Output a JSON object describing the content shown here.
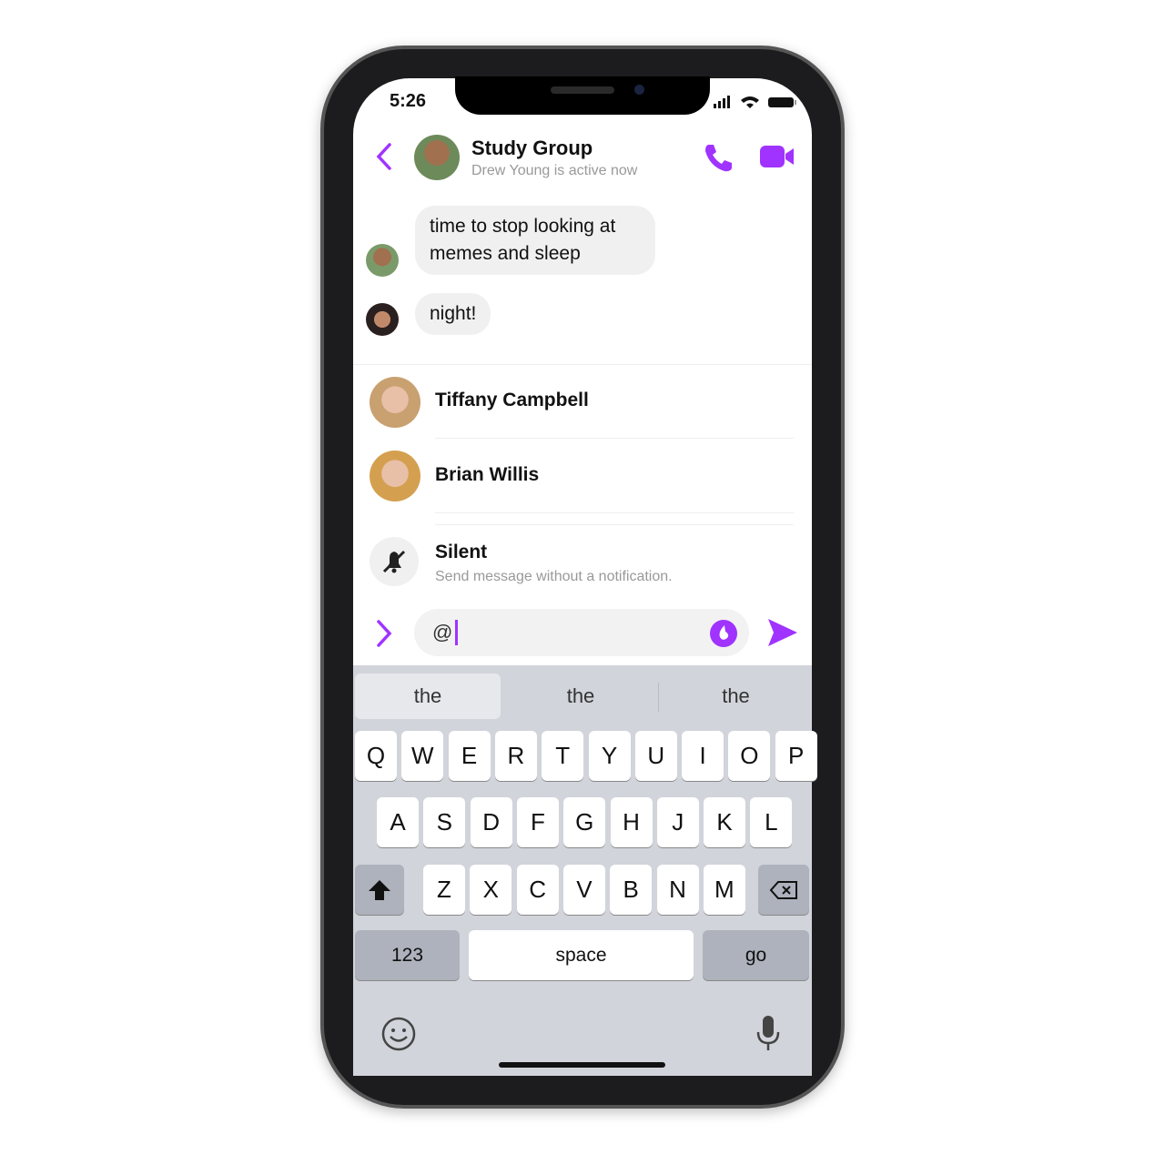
{
  "status": {
    "time": "5:26"
  },
  "header": {
    "title": "Study Group",
    "subtitle": "Drew Young is active now",
    "accent": "#a033ff"
  },
  "messages": [
    {
      "text": "time to stop looking at memes and sleep"
    },
    {
      "text": "night!"
    }
  ],
  "mentions": [
    {
      "name": "Tiffany Campbell"
    },
    {
      "name": "Brian Willis"
    }
  ],
  "silent": {
    "title": "Silent",
    "description": "Send message without a notification."
  },
  "composer": {
    "value": "@"
  },
  "keyboard": {
    "suggestions": [
      "the",
      "the",
      "the"
    ],
    "row1": [
      "Q",
      "W",
      "E",
      "R",
      "T",
      "Y",
      "U",
      "I",
      "O",
      "P"
    ],
    "row2": [
      "A",
      "S",
      "D",
      "F",
      "G",
      "H",
      "J",
      "K",
      "L"
    ],
    "row3": [
      "Z",
      "X",
      "C",
      "V",
      "B",
      "N",
      "M"
    ],
    "numbers": "123",
    "space": "space",
    "go": "go"
  }
}
